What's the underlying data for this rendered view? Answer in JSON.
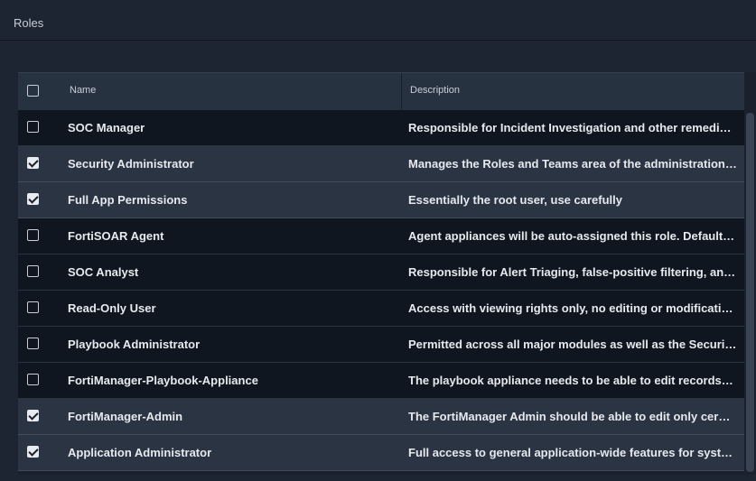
{
  "section": {
    "title": "Roles"
  },
  "table": {
    "columns": {
      "name": "Name",
      "description": "Description"
    },
    "rows": [
      {
        "name": "SOC Manager",
        "description": "Responsible for Incident Investigation and other remedi…",
        "checked": false
      },
      {
        "name": "Security Administrator",
        "description": "Manages the Roles and Teams area of the administration…",
        "checked": true
      },
      {
        "name": "Full App Permissions",
        "description": "Essentially the root user, use carefully",
        "checked": true
      },
      {
        "name": "FortiSOAR Agent",
        "description": "Agent appliances will be auto-assigned this role. Default…",
        "checked": false
      },
      {
        "name": "SOC Analyst",
        "description": "Responsible for Alert Triaging, false-positive filtering, an…",
        "checked": false
      },
      {
        "name": "Read-Only User",
        "description": "Access with viewing rights only, no editing or modificati…",
        "checked": false
      },
      {
        "name": "Playbook Administrator",
        "description": "Permitted across all major modules as well as the Securi…",
        "checked": false
      },
      {
        "name": "FortiManager-Playbook-Appliance",
        "description": "The playbook appliance needs to be able to edit records…",
        "checked": false
      },
      {
        "name": "FortiManager-Admin",
        "description": "The FortiManager Admin should be able to edit only cer…",
        "checked": true
      },
      {
        "name": "Application Administrator",
        "description": "Full access to general application-wide features for syst…",
        "checked": true
      }
    ]
  },
  "colors": {
    "background": "#1d2533",
    "header": "#273241",
    "row": "#10161f",
    "row_selected": "#2b3442",
    "text": "#e6e9ee"
  },
  "icons": {
    "checkbox": "checkbox-icon",
    "checkmark": "checkmark-icon"
  }
}
